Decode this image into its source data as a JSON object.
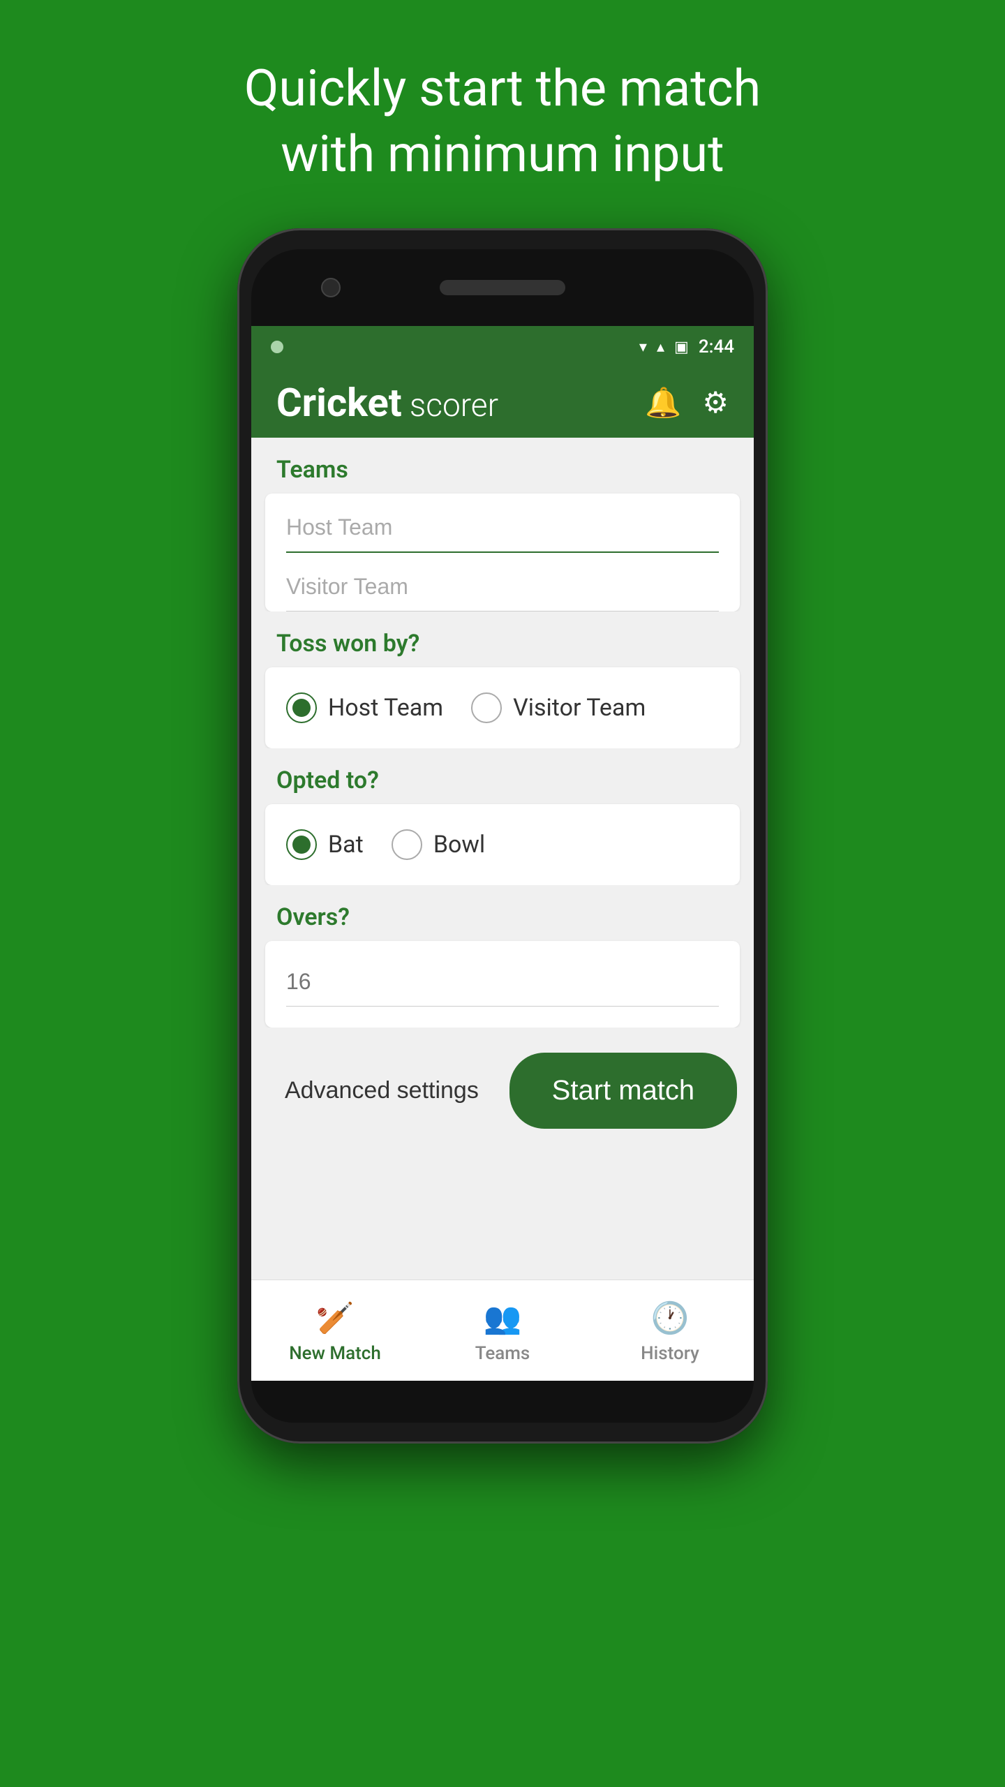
{
  "hero": {
    "text": "Quickly start the match with minimum input"
  },
  "statusBar": {
    "time": "2:44",
    "wifi": "▲",
    "signal": "▲",
    "battery": "▣"
  },
  "appBar": {
    "titleBold": "Cricket",
    "titleLight": " scorer",
    "bellIcon": "🔔",
    "gearIcon": "⚙"
  },
  "teamsSection": {
    "label": "Teams",
    "hostPlaceholder": "Host Team",
    "visitorPlaceholder": "Visitor Team"
  },
  "tossSection": {
    "label": "Toss won by?",
    "options": [
      "Host Team",
      "Visitor Team"
    ],
    "selected": "Host Team"
  },
  "optedSection": {
    "label": "Opted to?",
    "options": [
      "Bat",
      "Bowl"
    ],
    "selected": "Bat"
  },
  "oversSection": {
    "label": "Overs?",
    "placeholder": "16"
  },
  "actions": {
    "advancedSettings": "Advanced settings",
    "startMatch": "Start match"
  },
  "bottomNav": {
    "items": [
      {
        "label": "New Match",
        "icon": "🏏",
        "active": true
      },
      {
        "label": "Teams",
        "icon": "👥",
        "active": false
      },
      {
        "label": "History",
        "icon": "🕐",
        "active": false
      }
    ]
  }
}
